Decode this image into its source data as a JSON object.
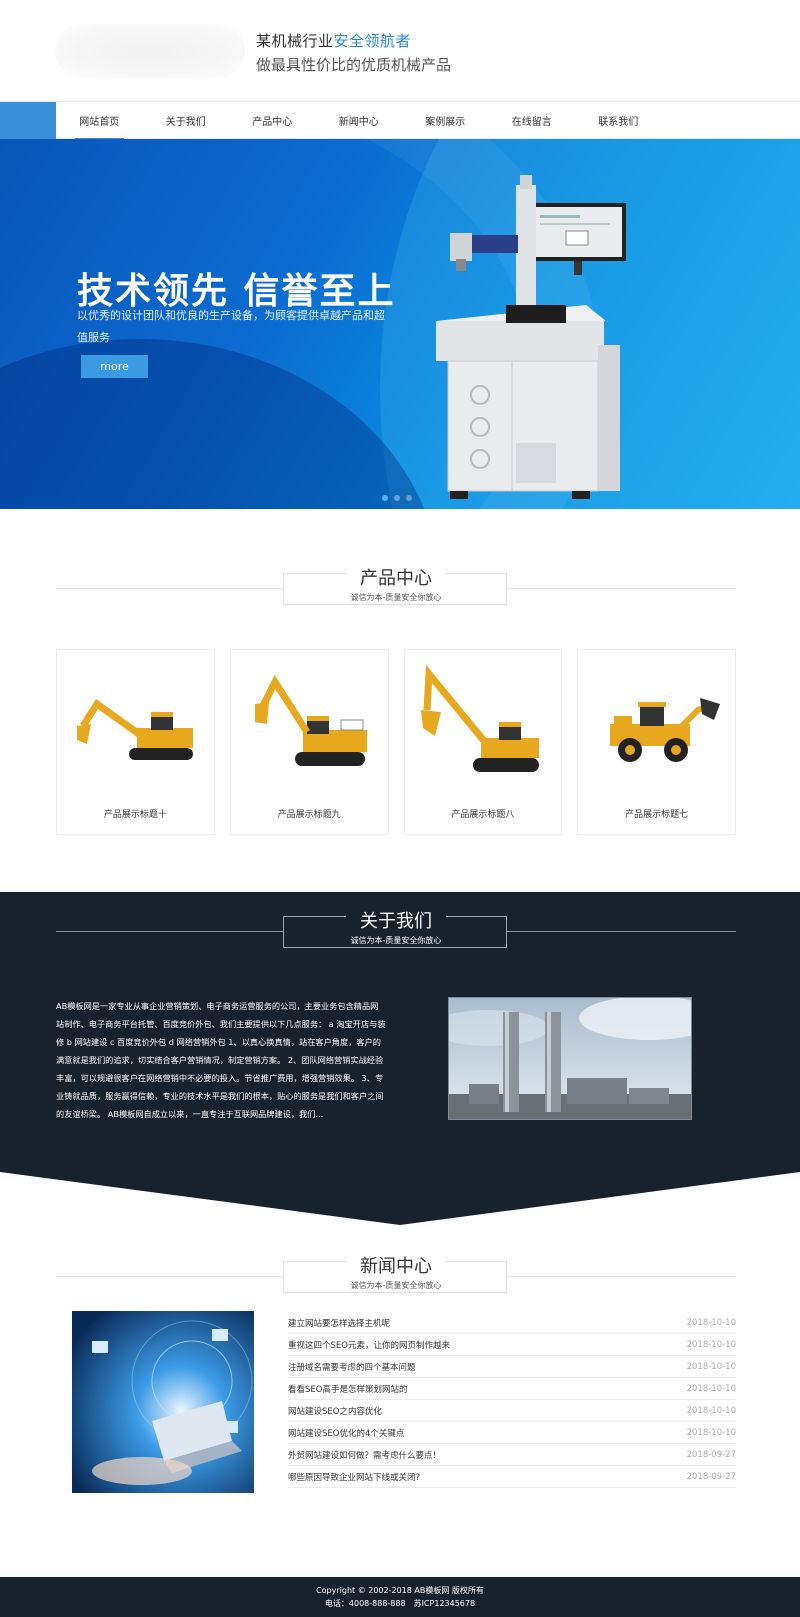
{
  "header": {
    "slogan_prefix": "某机械行业",
    "slogan_highlight": "安全领航者",
    "slogan_line2": "做最具性价比的优质机械产品"
  },
  "nav": {
    "items": [
      "网站首页",
      "关于我们",
      "产品中心",
      "新闻中心",
      "案例展示",
      "在线留言",
      "联系我们"
    ],
    "active_index": 0
  },
  "banner": {
    "title": "技术领先 信誉至上",
    "description": "以优秀的设计团队和优良的生产设备，为顾客提供卓越产品和超值服务",
    "more_label": "more",
    "slides_count": 3,
    "active_slide": 0
  },
  "products": {
    "title": "产品中心",
    "subtitle": "诚信为本-质量安全你放心",
    "items": [
      {
        "name": "产品展示标题十",
        "icon": "excavator-icon"
      },
      {
        "name": "产品展示标题九",
        "icon": "excavator-icon"
      },
      {
        "name": "产品展示标题八",
        "icon": "excavator-icon"
      },
      {
        "name": "产品展示标题七",
        "icon": "wheel-loader-icon"
      }
    ]
  },
  "about": {
    "title": "关于我们",
    "subtitle": "诚信为本-质量安全你放心",
    "text": "AB模板网是一家专业从事企业营销策划、电子商务运营服务的公司，主要业务包含精品网站制作、电子商务平台托管、百度竞价外包、我们主要提供以下几点服务： a 淘宝开店与装修 b 网站建设 c 百度竞价外包 d 网络营销外包 1、以真心换真情，站在客户角度，客户的满意就是我们的追求，切实结合客户营销情况，制定营销方案。 2、团队网络营销实战经验丰富，可以规避很客户在网络营销中不必要的投入。节省推广费用，增强营销效果。 3、专业铸就品质，服务赢得信赖，专业的技术水平是我们的根本，贴心的服务是我们和客户之间的友谊桥梁。 AB模板网自成立以来，一直专注于互联网品牌建设，我们..."
  },
  "news": {
    "title": "新闻中心",
    "subtitle": "诚信为本-质量安全你放心",
    "items": [
      {
        "title": "建立网站要怎样选择主机呢",
        "date": "2018-10-10"
      },
      {
        "title": "重视这四个SEO元素，让你的网页制作越来",
        "date": "2018-10-10"
      },
      {
        "title": "注册域名需要考虑的四个基本问题",
        "date": "2018-10-10"
      },
      {
        "title": "看看SEO高手是怎样策划网站的",
        "date": "2018-10-10"
      },
      {
        "title": "网站建设SEO之内容优化",
        "date": "2018-10-10"
      },
      {
        "title": "网站建设SEO优化的4个关键点",
        "date": "2018-10-10"
      },
      {
        "title": "外贸网站建设如何做？需考虑什么要点！",
        "date": "2018-09-27"
      },
      {
        "title": "哪些原因导致企业网站下线或关闭?",
        "date": "2018-09-27"
      }
    ]
  },
  "footer": {
    "copyright": "Copyright © 2002-2018 AB模板网 版权所有",
    "contact": "电话：4008-888-888　苏ICP12345678"
  },
  "colors": {
    "accent": "#3a90d8",
    "dark": "#18222d",
    "banner_blue": "#0a6bd0"
  }
}
